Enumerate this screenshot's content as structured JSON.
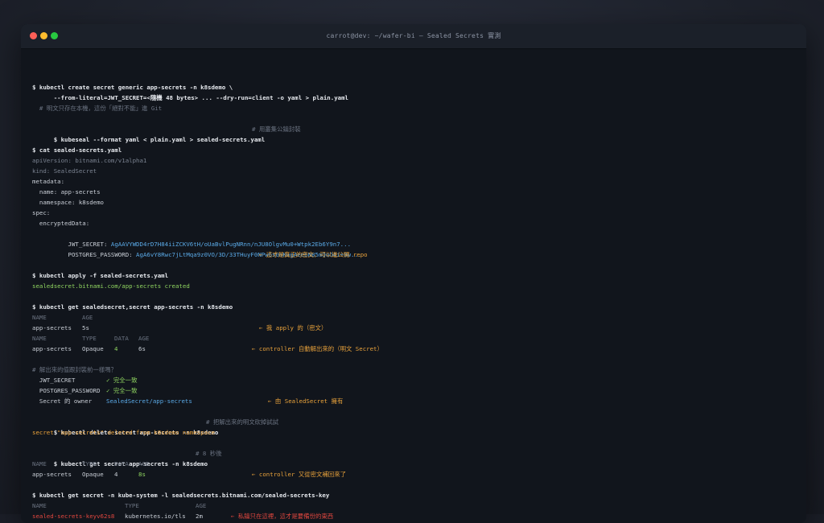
{
  "window": {
    "title": "carrot@dev: ~/wafer-bi — Sealed Secrets 實測"
  },
  "lines": {
    "l1": "$ kubectl create secret generic app-secrets -n k8sdemo \\",
    "l2": "      --from-literal=JWT_SECRET=<隨機 48 bytes> ... --dry-run=client -o yaml > plain.yaml",
    "l3": "  # 明文只存在本機，這份「絕對不能」進 Git",
    "l4_cmd": "$ kubeseal --format yaml < plain.yaml > sealed-secrets.yaml",
    "l4_cmt": "# 用叢集公鑰封裝",
    "l5": "$ cat sealed-secrets.yaml",
    "l6": "apiVersion: bitnami.com/v1alpha1",
    "l7": "kind: SealedSecret",
    "l8": "metadata:",
    "l9": "  name: app-secrets",
    "l10": "  namespace: k8sdemo",
    "l11": "spec:",
    "l12": "  encryptedData:",
    "l13_key": "    JWT_SECRET: ",
    "l13_val": "AgAAVYWDD4rD7H84iiZCKV6tH/oUaBvlPugNRnn/nJU8OlgvMu0+Wtpk2Eb6Y9n7...",
    "l14_key": "    POSTGRES_PASSWORD: ",
    "l14_val": "AgA6vY8Rwc7jLtMqa9z0VO/3D/33THuyF0NPwGs0nKwgAeebN85mQoO4i+8w...",
    "l15": "← 這才是真正的密文，可以進公開 repo",
    "l16": "$ kubectl apply -f sealed-secrets.yaml",
    "l17": "sealedsecret.bitnami.com/app-secrets created",
    "l18": "$ kubectl get sealedsecret,secret app-secrets -n k8sdemo",
    "l19_h1": "NAME",
    "l19_h2": "AGE",
    "l20_name": "app-secrets",
    "l20_age": "5s",
    "l20_note": "← 我 apply 的（密文）",
    "l21_h1": "NAME",
    "l21_h2": "TYPE",
    "l21_h3": "DATA",
    "l21_h4": "AGE",
    "l22_name": "app-secrets",
    "l22_type": "Opaque",
    "l22_data": "4",
    "l22_age": "6s",
    "l22_note": "← controller 自動解出來的（明文 Secret）",
    "l23": "# 解出來的值跟封裝前一樣嗎？",
    "l24_key": "  JWT_SECRET",
    "l24_val": "✓ 完全一致",
    "l25_key": "  POSTGRES_PASSWORD",
    "l25_val": "✓ 完全一致",
    "l26_key": "  Secret 的 owner",
    "l26_val": "SealedSecret/app-secrets",
    "l26_note": "← 由 SealedSecret 擁有",
    "l27_cmd": "$ kubectl delete secret app-secrets -n k8sdemo",
    "l27_cmt": "# 把解出來的明文砍掉試試",
    "l28": "secret \"app-secrets\" deleted from k8sdemo namespace",
    "l29_cmd": "$ kubectl get secret app-secrets -n k8sdemo",
    "l29_cmt": "# 8 秒後",
    "l30_h1": "NAME",
    "l30_h2": "TYPE",
    "l30_h3": "DATA",
    "l30_h4": "AGE",
    "l31_name": "app-secrets",
    "l31_type": "Opaque",
    "l31_data": "4",
    "l31_age": "8s",
    "l31_note": "← controller 又從密文補回來了",
    "l32": "$ kubectl get secret -n kube-system -l sealedsecrets.bitnami.com/sealed-secrets-key",
    "l33_h1": "NAME",
    "l33_h2": "TYPE",
    "l33_h3": "AGE",
    "l34_name": "sealed-secrets-keyv62s8",
    "l34_type": "kubernetes.io/tls",
    "l34_age": "2m",
    "l34_note": "← 私鑰只在這裡，這才是要備份的東西"
  },
  "colors": {
    "command": "#e6e9ee",
    "comment": "#6a7280",
    "cipher": "#5aa9e6",
    "success": "#8fd460",
    "annotation": "#e9a23b",
    "warning": "#e2473f"
  }
}
